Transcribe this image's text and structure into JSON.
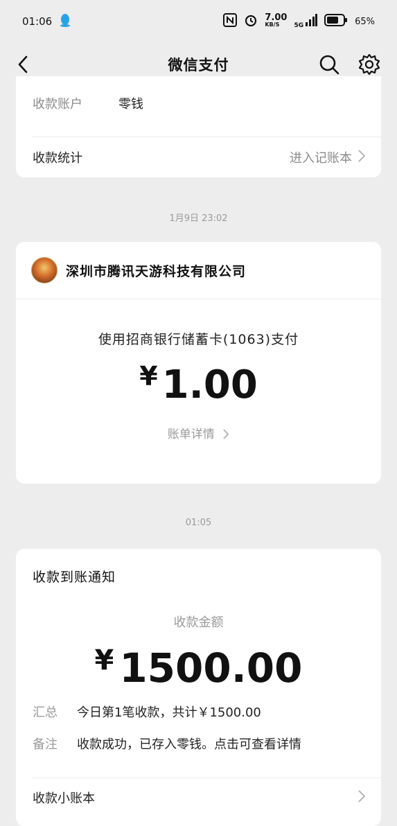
{
  "status_bar": {
    "time": "01:06",
    "network_speed": "7.00",
    "network_unit": "KB/S",
    "signal": "5G",
    "battery": "65%"
  },
  "nav": {
    "title": "微信支付"
  },
  "top_card": {
    "account_label": "收款账户",
    "account_value": "零钱",
    "stats_label": "收款统计",
    "stats_link": "进入记账本"
  },
  "timestamps": {
    "first": "1月9日 23:02",
    "second": "01:05"
  },
  "payment_card": {
    "merchant": "深圳市腾讯天游科技有限公司",
    "method": "使用招商银行储蓄卡(1063)支付",
    "currency": "¥",
    "amount": "1.00",
    "detail_link": "账单详情"
  },
  "receipt_card": {
    "title": "收款到账通知",
    "amount_label": "收款金额",
    "currency": "¥",
    "amount": "1500.00",
    "summary_key": "汇总",
    "summary_value": "今日第1笔收款，共计￥1500.00",
    "remark_key": "备注",
    "remark_value": "收款成功，已存入零钱。点击可查看详情",
    "ledger_link": "收款小账本"
  }
}
